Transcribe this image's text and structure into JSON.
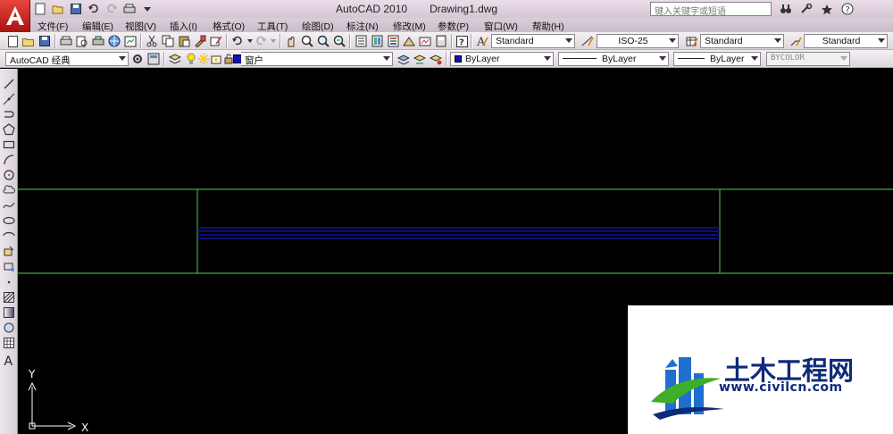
{
  "titlebar": {
    "app_name": "AutoCAD 2010",
    "document_name": "Drawing1.dwg",
    "search_placeholder": "键入关键字或短语",
    "qat_buttons": [
      "new-icon",
      "open-icon",
      "save-icon",
      "undo-icon",
      "redo-icon",
      "plot-icon",
      "dropdown-icon"
    ],
    "right_icons": [
      "binoculars-icon",
      "tools-icon",
      "star-icon",
      "help-icon"
    ]
  },
  "menubar": {
    "items": [
      "文件(F)",
      "编辑(E)",
      "视图(V)",
      "插入(I)",
      "格式(O)",
      "工具(T)",
      "绘图(D)",
      "标注(N)",
      "修改(M)",
      "参数(P)",
      "窗口(W)",
      "帮助(H)"
    ]
  },
  "toolbar1": {
    "text_style": "Standard",
    "dim_style": "ISO-25",
    "table_style": "Standard",
    "multileader_style": "Standard"
  },
  "toolbar2": {
    "workspace": "AutoCAD 经典",
    "layer": "窗户",
    "color": "ByLayer",
    "linetype": "ByLayer",
    "lineweight": "ByLayer",
    "plotstyle": "BYCOLOR",
    "color_swatch": "#1010c0"
  },
  "drawing": {
    "colors": {
      "frame": "#3cab3c",
      "window_lines": "#1414c8",
      "ucs": "#ffffff",
      "background": "#000000"
    },
    "ucs_y_label": "Y",
    "ucs_x_label": "X"
  },
  "watermark": {
    "title": "土木工程网",
    "url": "www.civilcn.com",
    "colors": {
      "brand_blue": "#0e2a7a",
      "swoosh_green": "#3fae2a"
    }
  }
}
